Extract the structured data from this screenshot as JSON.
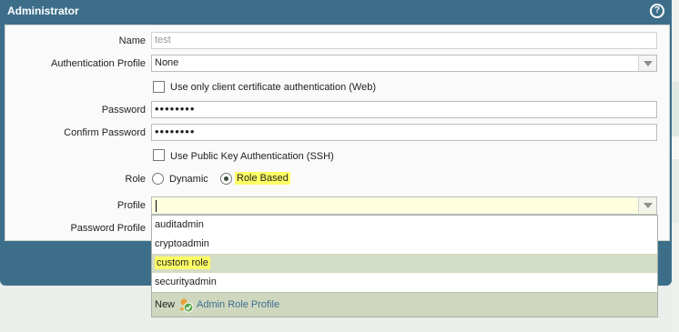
{
  "dialog": {
    "title": "Administrator",
    "help_icon": "help-icon"
  },
  "form": {
    "name": {
      "label": "Name",
      "value": "test"
    },
    "auth_profile": {
      "label": "Authentication Profile",
      "value": "None"
    },
    "client_cert": {
      "label": "Use only client certificate authentication (Web)"
    },
    "password": {
      "label": "Password",
      "value": "••••••••"
    },
    "confirm_password": {
      "label": "Confirm Password",
      "value": "••••••••"
    },
    "public_key": {
      "label": "Use Public Key Authentication (SSH)"
    },
    "role": {
      "label": "Role",
      "options": [
        "Dynamic",
        "Role Based"
      ],
      "selected": "Role Based"
    },
    "profile": {
      "label": "Profile",
      "value": ""
    },
    "password_profile": {
      "label": "Password Profile"
    }
  },
  "dropdown": {
    "items": [
      "auditadmin",
      "cryptoadmin",
      "custom role",
      "securityadmin"
    ],
    "selected": "custom role",
    "footer": {
      "new_label": "New",
      "link_label": "Admin Role Profile",
      "icon": "admin-role-icon"
    }
  },
  "colors": {
    "titlebar": "#3c6e8a",
    "highlight": "#ffff66",
    "selected_row": "#d3dcc4",
    "link": "#3f6f8f"
  }
}
